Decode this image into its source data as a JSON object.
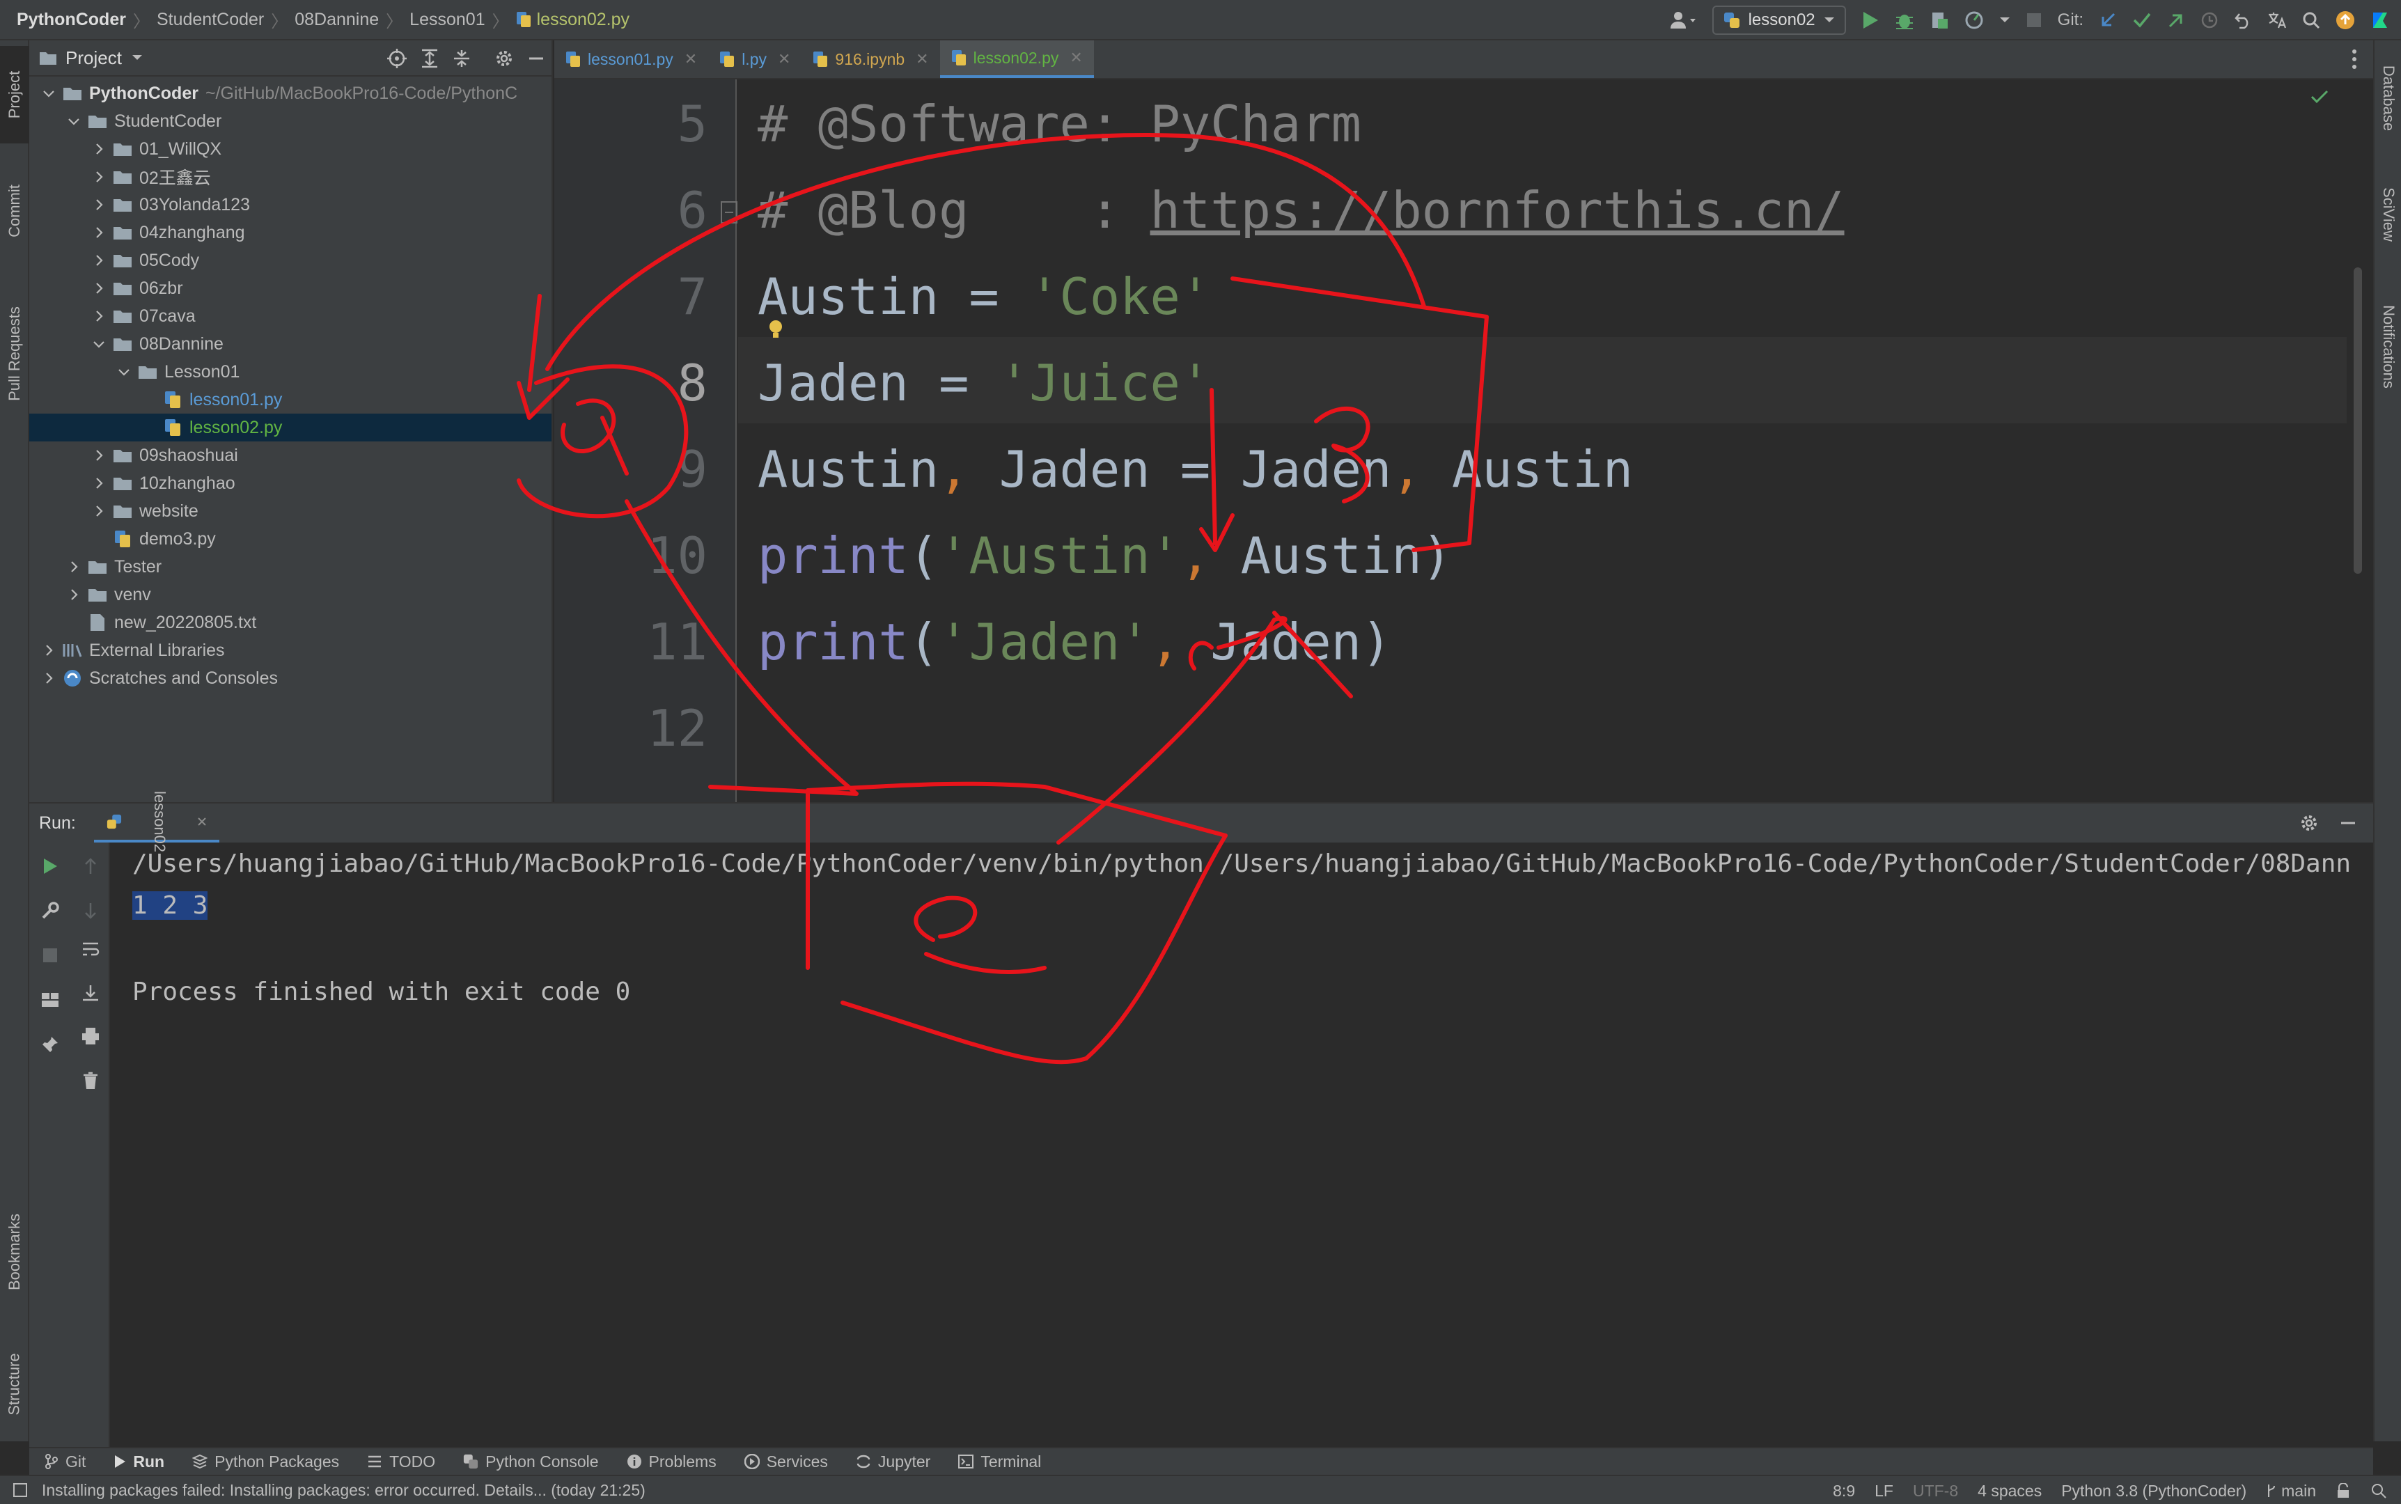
{
  "breadcrumb": [
    "PythonCoder",
    "StudentCoder",
    "08Dannine",
    "Lesson01",
    "lesson02.py"
  ],
  "toolbar": {
    "run_config": "lesson02",
    "git_label": "Git:"
  },
  "left_stripe": [
    "Project",
    "Commit",
    "Pull Requests",
    "Bookmarks",
    "Structure"
  ],
  "right_stripe": [
    "Database",
    "SciView",
    "Notifications"
  ],
  "project": {
    "title": "Project",
    "tree": [
      {
        "label": "PythonCoder",
        "path": "~/GitHub/MacBookPro16-Code/PythonC",
        "depth": 0,
        "kind": "root",
        "expanded": true
      },
      {
        "label": "StudentCoder",
        "depth": 1,
        "kind": "folder",
        "expanded": true
      },
      {
        "label": "01_WillQX",
        "depth": 2,
        "kind": "folder"
      },
      {
        "label": "02王鑫云",
        "depth": 2,
        "kind": "folder"
      },
      {
        "label": "03Yolanda123",
        "depth": 2,
        "kind": "folder"
      },
      {
        "label": "04zhanghang",
        "depth": 2,
        "kind": "folder"
      },
      {
        "label": "05Cody",
        "depth": 2,
        "kind": "folder"
      },
      {
        "label": "06zbr",
        "depth": 2,
        "kind": "folder"
      },
      {
        "label": "07cava",
        "depth": 2,
        "kind": "folder"
      },
      {
        "label": "08Dannine",
        "depth": 2,
        "kind": "folder",
        "expanded": true
      },
      {
        "label": "Lesson01",
        "depth": 3,
        "kind": "folder",
        "expanded": true
      },
      {
        "label": "lesson01.py",
        "depth": 4,
        "kind": "py"
      },
      {
        "label": "lesson02.py",
        "depth": 4,
        "kind": "py",
        "selected": true
      },
      {
        "label": "09shaoshuai",
        "depth": 2,
        "kind": "folder"
      },
      {
        "label": "10zhanghao",
        "depth": 2,
        "kind": "folder"
      },
      {
        "label": "website",
        "depth": 2,
        "kind": "folder"
      },
      {
        "label": "demo3.py",
        "depth": 2,
        "kind": "pyfile"
      },
      {
        "label": "Tester",
        "depth": 1,
        "kind": "folder"
      },
      {
        "label": "venv",
        "depth": 1,
        "kind": "folder"
      },
      {
        "label": "new_20220805.txt",
        "depth": 1,
        "kind": "txt"
      },
      {
        "label": "External Libraries",
        "depth": 0,
        "kind": "lib"
      },
      {
        "label": "Scratches and Consoles",
        "depth": 0,
        "kind": "scratch"
      }
    ]
  },
  "editor": {
    "tabs": [
      {
        "label": "lesson01.py",
        "color": "#5a9bd6",
        "active": false
      },
      {
        "label": "l.py",
        "color": "#5a9bd6",
        "active": false
      },
      {
        "label": "916.ipynb",
        "color": "#d0a650",
        "active": false
      },
      {
        "label": "lesson02.py",
        "color": "#62b543",
        "active": true
      }
    ],
    "line_numbers": [
      "5",
      "6",
      "7",
      "8",
      "9",
      "10",
      "11",
      "12"
    ],
    "current_line": "8",
    "code": {
      "l5": "# @Software: PyCharm",
      "l6_prefix": "# @Blog    : ",
      "l6_link": "https://bornforthis.cn/",
      "l7_var": "Austin = ",
      "l7_str": "'Coke'",
      "l8_var": "Jaden = ",
      "l8_str": "'Juice'",
      "l9_a": "Austin",
      "l9_comma1": ",",
      "l9_b": " Jaden = Jaden",
      "l9_comma2": ",",
      "l9_c": " Austin",
      "l10_fn": "print",
      "l10_open": "(",
      "l10_str": "'Austin'",
      "l10_comma": ",",
      "l10_rest": " Austin)",
      "l11_fn": "print",
      "l11_open": "(",
      "l11_str": "'Jaden'",
      "l11_comma": ",",
      "l11_rest": " Jaden)"
    }
  },
  "run": {
    "label": "Run:",
    "tab": "lesson02",
    "command": "/Users/huangjiabao/GitHub/MacBookPro16-Code/PythonCoder/venv/bin/python /Users/huangjiabao/GitHub/MacBookPro16-Code/PythonCoder/StudentCoder/08Dann",
    "output": "1 2 3",
    "exit": "Process finished with exit code 0"
  },
  "bottom_tools": [
    "Git",
    "Run",
    "Python Packages",
    "TODO",
    "Python Console",
    "Problems",
    "Services",
    "Jupyter",
    "Terminal"
  ],
  "status": {
    "message": "Installing packages failed: Installing packages: error occurred. Details... (today 21:25)",
    "position": "8:9",
    "line_sep": "LF",
    "encoding": "UTF-8",
    "indent": "4 spaces",
    "interpreter": "Python 3.8 (PythonCoder)",
    "branch": "main"
  },
  "colors": {
    "annotation_ink": "#e8141b",
    "accent": "#4a88c7",
    "selection": "#0d293e"
  }
}
